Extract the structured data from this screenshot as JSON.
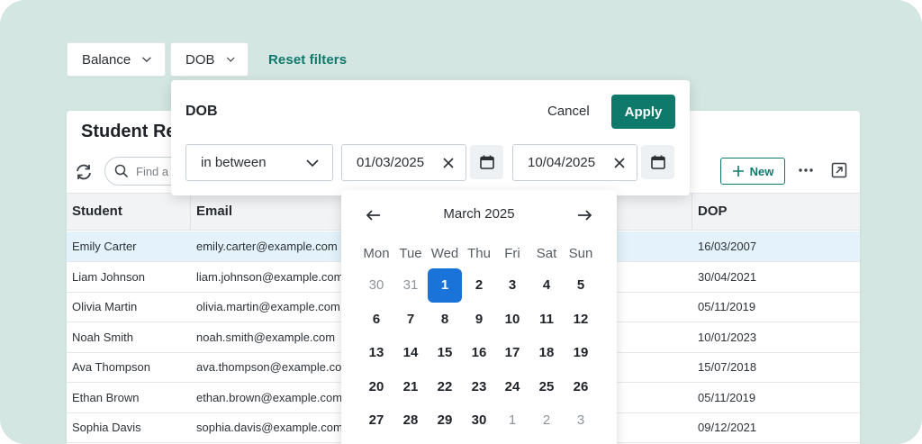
{
  "filters": {
    "chips": [
      {
        "label": "Balance"
      },
      {
        "label": "DOB"
      }
    ],
    "reset_label": "Reset filters"
  },
  "card": {
    "title": "Student Rep",
    "search_placeholder": "Find a",
    "new_label": "New",
    "columns": [
      "Student",
      "Email",
      "DOP"
    ],
    "rows": [
      {
        "student": "Emily Carter",
        "email": "emily.carter@example.com",
        "dop": "16/03/2007",
        "selected": true
      },
      {
        "student": "Liam Johnson",
        "email": "liam.johnson@example.com",
        "dop": "30/04/2021"
      },
      {
        "student": "Olivia Martin",
        "email": "olivia.martin@example.com",
        "dop": "05/11/2019"
      },
      {
        "student": "Noah Smith",
        "email": "noah.smith@example.com",
        "dop": "10/01/2023"
      },
      {
        "student": "Ava Thompson",
        "email": "ava.thompson@example.com",
        "dop": "15/07/2018"
      },
      {
        "student": "Ethan Brown",
        "email": "ethan.brown@example.com",
        "dop": "05/11/2019"
      },
      {
        "student": "Sophia Davis",
        "email": "sophia.davis@example.com",
        "dop": "09/12/2021"
      }
    ]
  },
  "popover": {
    "title": "DOB",
    "cancel_label": "Cancel",
    "apply_label": "Apply",
    "operator": "in between",
    "date_from": "01/03/2025",
    "date_to": "10/04/2025"
  },
  "calendar": {
    "month_label": "March 2025",
    "weekdays": [
      "Mon",
      "Tue",
      "Wed",
      "Thu",
      "Fri",
      "Sat",
      "Sun"
    ],
    "weeks": [
      [
        {
          "d": "30",
          "muted": true
        },
        {
          "d": "31",
          "muted": true
        },
        {
          "d": "1",
          "selected": true
        },
        {
          "d": "2"
        },
        {
          "d": "3"
        },
        {
          "d": "4"
        },
        {
          "d": "5"
        }
      ],
      [
        {
          "d": "6"
        },
        {
          "d": "7"
        },
        {
          "d": "8"
        },
        {
          "d": "9"
        },
        {
          "d": "10"
        },
        {
          "d": "11"
        },
        {
          "d": "12"
        }
      ],
      [
        {
          "d": "13"
        },
        {
          "d": "14"
        },
        {
          "d": "15"
        },
        {
          "d": "16"
        },
        {
          "d": "17"
        },
        {
          "d": "18"
        },
        {
          "d": "19"
        }
      ],
      [
        {
          "d": "20"
        },
        {
          "d": "21"
        },
        {
          "d": "22"
        },
        {
          "d": "23"
        },
        {
          "d": "24"
        },
        {
          "d": "25"
        },
        {
          "d": "26"
        }
      ],
      [
        {
          "d": "27"
        },
        {
          "d": "28"
        },
        {
          "d": "29"
        },
        {
          "d": "30"
        },
        {
          "d": "1",
          "muted": true
        },
        {
          "d": "2",
          "muted": true
        },
        {
          "d": "3",
          "muted": true
        }
      ]
    ]
  },
  "colors": {
    "background": "#d3e6e1",
    "accent": "#0f7a6c",
    "selected_day": "#1a73d9",
    "selected_row": "#e3f2fb"
  }
}
